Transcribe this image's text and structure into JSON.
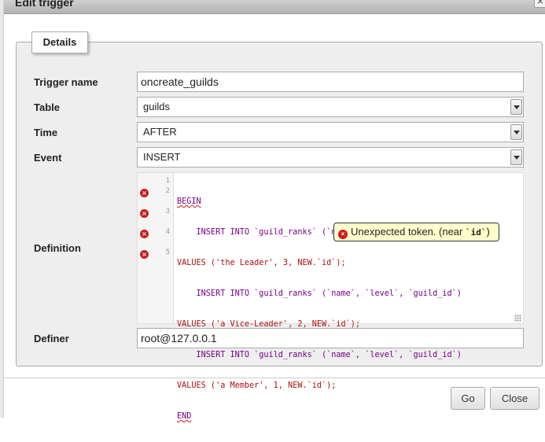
{
  "dialog": {
    "title": "Edit trigger",
    "close_glyph": "×"
  },
  "fieldset": {
    "legend": "Details"
  },
  "fields": {
    "trigger_name": {
      "label": "Trigger name",
      "value": "oncreate_guilds"
    },
    "table": {
      "label": "Table",
      "value": "guilds"
    },
    "time": {
      "label": "Time",
      "value": "AFTER"
    },
    "event": {
      "label": "Event",
      "value": "INSERT"
    },
    "definition": {
      "label": "Definition"
    },
    "definer": {
      "label": "Definer",
      "value": "root@127.0.0.1"
    }
  },
  "editor": {
    "line_numbers": [
      "1",
      "2",
      "3",
      "4",
      "5"
    ],
    "code_lines": [
      "BEGIN",
      "    INSERT INTO `guild_ranks` (`name`, `level`, `guild_id`)",
      "VALUES ('the Leader', 3, NEW.`id`);",
      "    INSERT INTO `guild_ranks` (`name`, `level`, `guild_id`)",
      "VALUES ('a Vice-Leader', 2, NEW.`id`);",
      "    INSERT INTO `guild_ranks` (`name`, `level`, `guild_id`)",
      "VALUES ('a Member', 1, NEW.`id`);",
      "END"
    ],
    "error_marker_glyph": "×",
    "tooltip": {
      "text": "Unexpected token. (near ",
      "token": "`id`",
      "close": ")"
    }
  },
  "buttons": {
    "go": "Go",
    "close": "Close"
  },
  "colors": {
    "error": "#cc1d1d",
    "tooltip_bg": "#ffffcc",
    "keyword": "#770088",
    "string": "#aa1111"
  }
}
